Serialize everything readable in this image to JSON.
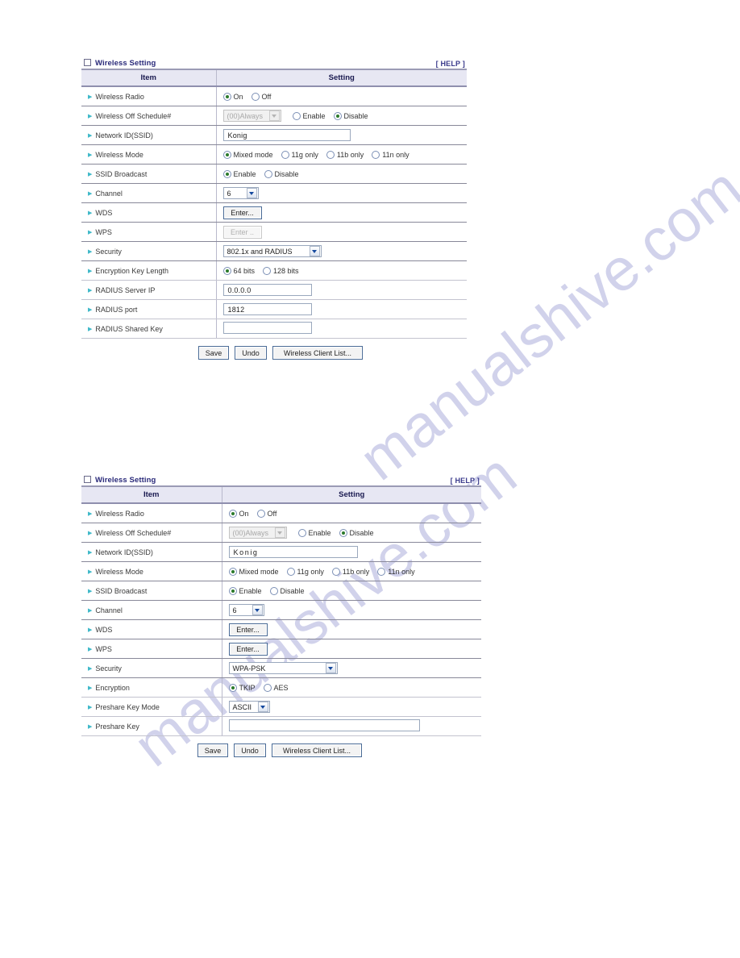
{
  "watermark": {
    "text_a": "manualshive.com",
    "text_b": "manualshive.com",
    "color": "#c9cbe8"
  },
  "common": {
    "panel_title": "Wireless Setting",
    "help_label": "[ HELP ]",
    "col_item": "Item",
    "col_setting": "Setting",
    "save_label": "Save",
    "undo_label": "Undo",
    "client_list_label": "Wireless Client List...",
    "enter_label": "Enter...",
    "enter_disabled_label": "Enter ..",
    "accent_title_color": "#2a2a7a",
    "header_bg": "#e7e7f3",
    "bullet_color": "#3fb9c9",
    "radio_dot_color": "#2b7a2b"
  },
  "panel1": {
    "rows": [
      {
        "label": "Wireless Radio",
        "type": "radio",
        "options": [
          {
            "label": "On",
            "selected": true
          },
          {
            "label": "Off",
            "selected": false
          }
        ]
      },
      {
        "label": "Wireless Off Schedule#",
        "type": "schedule",
        "select_value": "(00)Always",
        "select_disabled": true,
        "options": [
          {
            "label": "Enable",
            "selected": false
          },
          {
            "label": "Disable",
            "selected": true
          }
        ]
      },
      {
        "label": "Network ID(SSID)",
        "type": "text",
        "value": "Konig"
      },
      {
        "label": "Wireless Mode",
        "type": "radio",
        "options": [
          {
            "label": "Mixed mode",
            "selected": true
          },
          {
            "label": "11g only",
            "selected": false
          },
          {
            "label": "11b only",
            "selected": false
          },
          {
            "label": "11n only",
            "selected": false
          }
        ]
      },
      {
        "label": "SSID Broadcast",
        "type": "radio",
        "options": [
          {
            "label": "Enable",
            "selected": true
          },
          {
            "label": "Disable",
            "selected": false
          }
        ]
      },
      {
        "label": "Channel",
        "type": "select",
        "value": "6"
      },
      {
        "label": "WDS",
        "type": "button",
        "button": "Enter...",
        "disabled": false
      },
      {
        "label": "WPS",
        "type": "button",
        "button": "Enter ..",
        "disabled": true
      },
      {
        "label": "Security",
        "type": "select",
        "value": "802.1x and RADIUS"
      },
      {
        "label": "Encryption Key Length",
        "indent": true,
        "type": "radio",
        "options": [
          {
            "label": "64 bits",
            "selected": true
          },
          {
            "label": "128 bits",
            "selected": false
          }
        ]
      },
      {
        "label": "RADIUS Server IP",
        "indent": true,
        "type": "text",
        "value": "0.0.0.0"
      },
      {
        "label": "RADIUS port",
        "indent": true,
        "type": "text",
        "value": "1812"
      },
      {
        "label": "RADIUS Shared Key",
        "indent": true,
        "type": "text",
        "value": ""
      }
    ]
  },
  "panel2": {
    "rows": [
      {
        "label": "Wireless Radio",
        "type": "radio",
        "options": [
          {
            "label": "On",
            "selected": true
          },
          {
            "label": "Off",
            "selected": false
          }
        ]
      },
      {
        "label": "Wireless Off Schedule#",
        "type": "schedule",
        "select_value": "(00)Always",
        "select_disabled": true,
        "options": [
          {
            "label": "Enable",
            "selected": false
          },
          {
            "label": "Disable",
            "selected": true
          }
        ]
      },
      {
        "label": "Network ID(SSID)",
        "type": "text",
        "value": "Konig"
      },
      {
        "label": "Wireless Mode",
        "type": "radio",
        "options": [
          {
            "label": "Mixed mode",
            "selected": true
          },
          {
            "label": "11g only",
            "selected": false
          },
          {
            "label": "11b only",
            "selected": false
          },
          {
            "label": "11n only",
            "selected": false
          }
        ]
      },
      {
        "label": "SSID Broadcast",
        "type": "radio",
        "options": [
          {
            "label": "Enable",
            "selected": true
          },
          {
            "label": "Disable",
            "selected": false
          }
        ]
      },
      {
        "label": "Channel",
        "type": "select",
        "value": "6"
      },
      {
        "label": "WDS",
        "type": "button",
        "button": "Enter...",
        "disabled": false
      },
      {
        "label": "WPS",
        "type": "button",
        "button": "Enter...",
        "disabled": false
      },
      {
        "label": "Security",
        "type": "select",
        "value": "WPA-PSK"
      },
      {
        "label": "Encryption",
        "indent": true,
        "type": "radio",
        "options": [
          {
            "label": "TKIP",
            "selected": true
          },
          {
            "label": "AES",
            "selected": false
          }
        ]
      },
      {
        "label": "Preshare Key Mode",
        "indent": true,
        "type": "select",
        "value": "ASCII"
      },
      {
        "label": "Preshare Key",
        "indent": true,
        "type": "text",
        "value": ""
      }
    ]
  }
}
